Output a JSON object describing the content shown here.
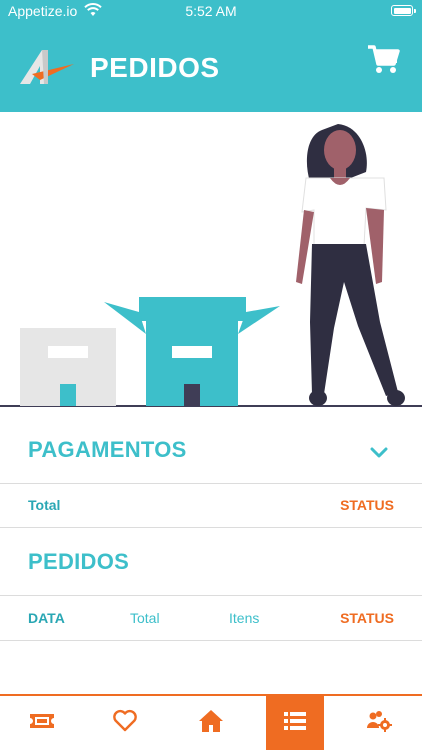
{
  "status_bar": {
    "carrier": "Appetize.io",
    "time": "5:52 AM"
  },
  "header": {
    "title": "PEDIDOS"
  },
  "payments": {
    "title": "PAGAMENTOS",
    "columns": {
      "total": "Total",
      "status": "STATUS"
    }
  },
  "orders": {
    "title": "PEDIDOS",
    "columns": {
      "date": "DATA",
      "total": "Total",
      "items": "Itens",
      "status": "STATUS"
    }
  },
  "tabbar": {
    "active_index": 3,
    "items": [
      "ticket-icon",
      "heart-icon",
      "home-icon",
      "list-icon",
      "users-gear-icon"
    ]
  },
  "colors": {
    "primary": "#3dbfca",
    "accent": "#ef6c22"
  }
}
